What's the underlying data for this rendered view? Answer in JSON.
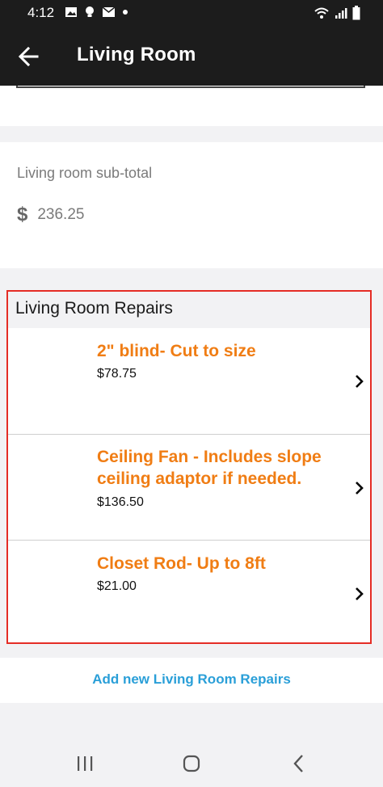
{
  "status": {
    "time": "4:12"
  },
  "header": {
    "title": "Living Room"
  },
  "subtotal": {
    "label": "Living room sub-total",
    "value": "236.25"
  },
  "section": {
    "title": "Living Room Repairs"
  },
  "items": [
    {
      "title": "2\" blind- Cut to size",
      "price": "$78.75"
    },
    {
      "title": "Ceiling Fan - Includes slope ceiling adaptor if needed.",
      "price": "$136.50"
    },
    {
      "title": "Closet Rod- Up to 8ft",
      "price": "$21.00"
    }
  ],
  "add": {
    "label": "Add new Living Room Repairs"
  },
  "icons": {
    "back": "arrow-left-icon",
    "dollar": "dollar-icon",
    "chevron": "chevron-right-icon",
    "nav": [
      "recent-apps-icon",
      "home-icon",
      "back-nav-icon"
    ]
  },
  "colors": {
    "accent": "#f07d14",
    "link": "#2a9fd8",
    "highlight": "#e52d25",
    "bar": "#1c1c1c"
  }
}
